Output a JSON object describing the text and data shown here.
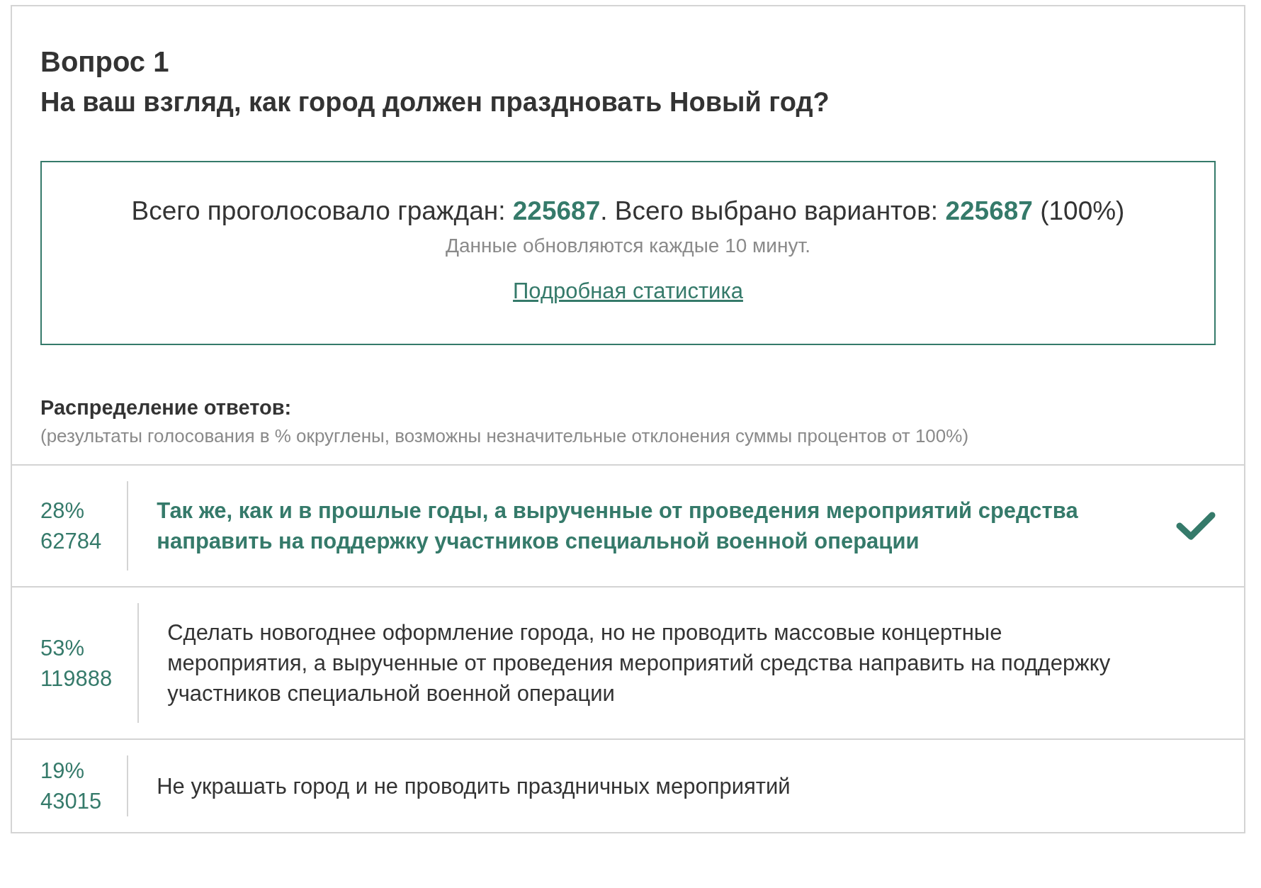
{
  "question": {
    "number": "Вопрос 1",
    "text": "На ваш взгляд, как город должен праздновать Новый год?"
  },
  "summary": {
    "totals": "Всего проголосовало граждан: **225687**. Всего выбрано вариантов: **225687** (100%)",
    "update_note": "Данные обновляются каждые 10 минут.",
    "link": "Подробная статистика"
  },
  "distribution": {
    "heading": "Распределение ответов:",
    "note": "(результаты голосования в % округлены, возможны незначительные отклонения суммы процентов от 100%)"
  },
  "answers": [
    {
      "percent": "28%",
      "count": "62784",
      "text": "Так же, как и в прошлые годы, а вырученные от проведения мероприятий средства направить на поддержку участников специальной военной операции",
      "selected": true
    },
    {
      "percent": "53%",
      "count": "119888",
      "text": "Сделать новогоднее оформление города, но не проводить массовые концертные мероприятия, а вырученные от проведения мероприятий средства направить на поддержку участников специальной военной операции",
      "selected": false
    },
    {
      "percent": "19%",
      "count": "43015",
      "text": "Не украшать город и не проводить праздничных мероприятий",
      "selected": false
    }
  ]
}
